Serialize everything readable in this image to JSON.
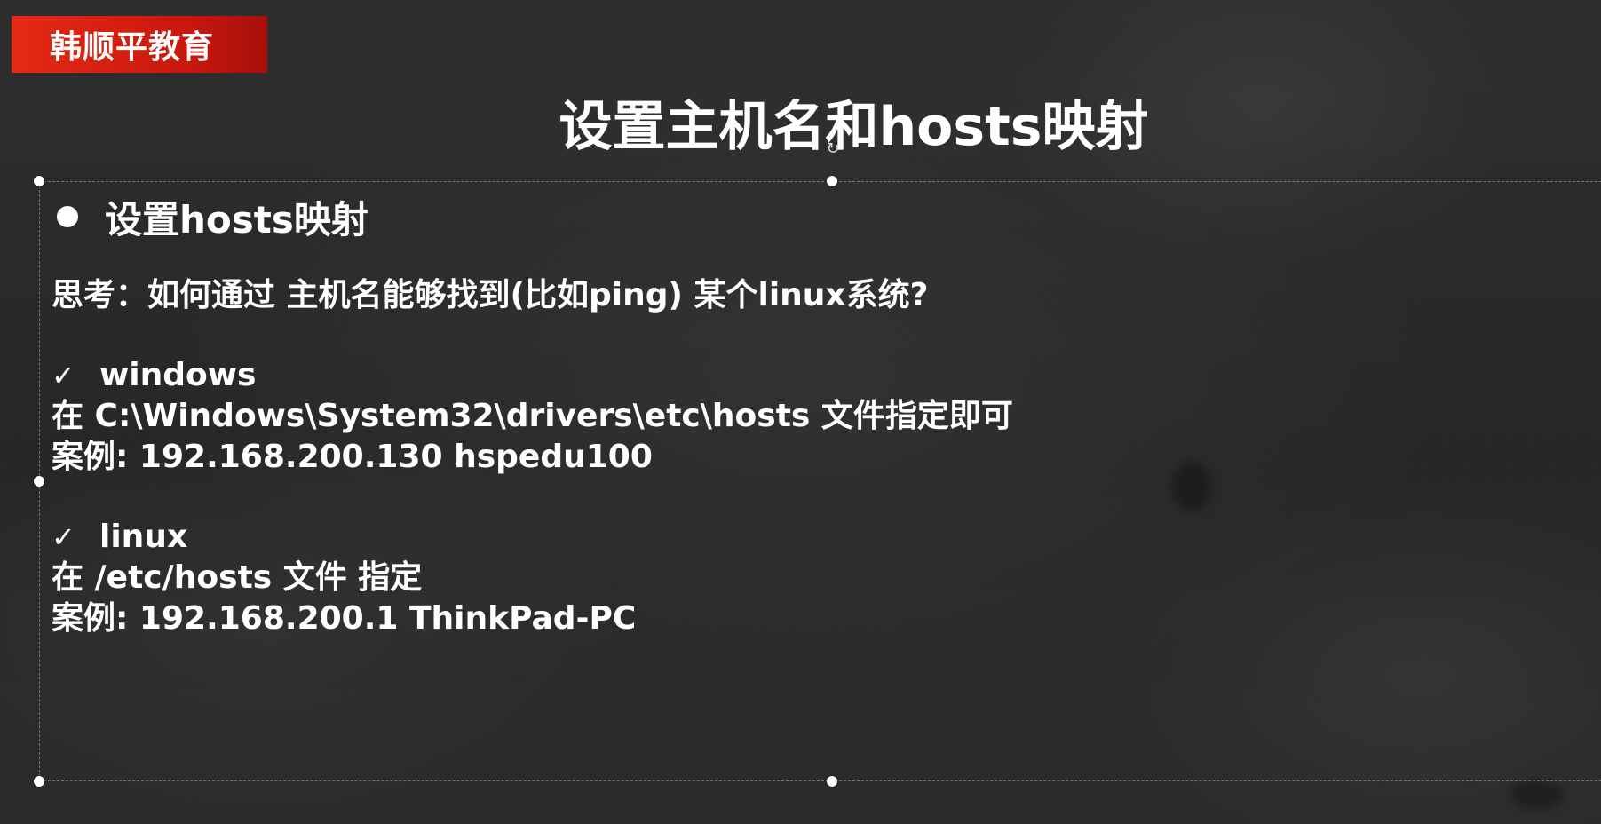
{
  "brand": {
    "name": "韩顺平教育",
    "color": "#e02712"
  },
  "slide": {
    "title": "设置主机名和hosts映射",
    "section_heading": "设置hosts映射",
    "question": "思考：如何通过 主机名能够找到(比如ping) 某个linux系统?",
    "windows": {
      "label": "windows",
      "location": "在 C:\\Windows\\System32\\drivers\\etc\\hosts 文件指定即可",
      "example": "案例: 192.168.200.130 hspedu100"
    },
    "linux": {
      "label": "linux",
      "location": "在 /etc/hosts 文件 指定",
      "example": "案例: 192.168.200.1 ThinkPad-PC"
    }
  },
  "icons": {
    "bullet": "filled-circle",
    "check": "✓",
    "rotate": "↻"
  }
}
